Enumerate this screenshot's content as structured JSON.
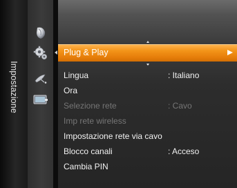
{
  "category": {
    "label": "Impostazione"
  },
  "icons": [
    {
      "name": "picture-icon"
    },
    {
      "name": "setup-gear-icon",
      "active": true
    },
    {
      "name": "satellite-dish-icon"
    },
    {
      "name": "input-screen-icon"
    }
  ],
  "menu": {
    "selected": {
      "label": "Plug & Play",
      "arrow": "►"
    },
    "items": [
      {
        "label": "Lingua",
        "value": ": Italiano",
        "enabled": true
      },
      {
        "label": "Ora",
        "value": "",
        "enabled": true
      },
      {
        "label": "Selezione rete",
        "value": ": Cavo",
        "enabled": false
      },
      {
        "label": "Imp rete wireless",
        "value": "",
        "enabled": false
      },
      {
        "label": "Impostazione rete via cavo",
        "value": "",
        "enabled": true
      },
      {
        "label": "Blocco canali",
        "value": ": Acceso",
        "enabled": true
      },
      {
        "label": "Cambia PIN",
        "value": "",
        "enabled": true
      }
    ]
  },
  "colors": {
    "highlight": "#f39419",
    "text": "#f2f2f2",
    "disabled_text": "#767676"
  }
}
